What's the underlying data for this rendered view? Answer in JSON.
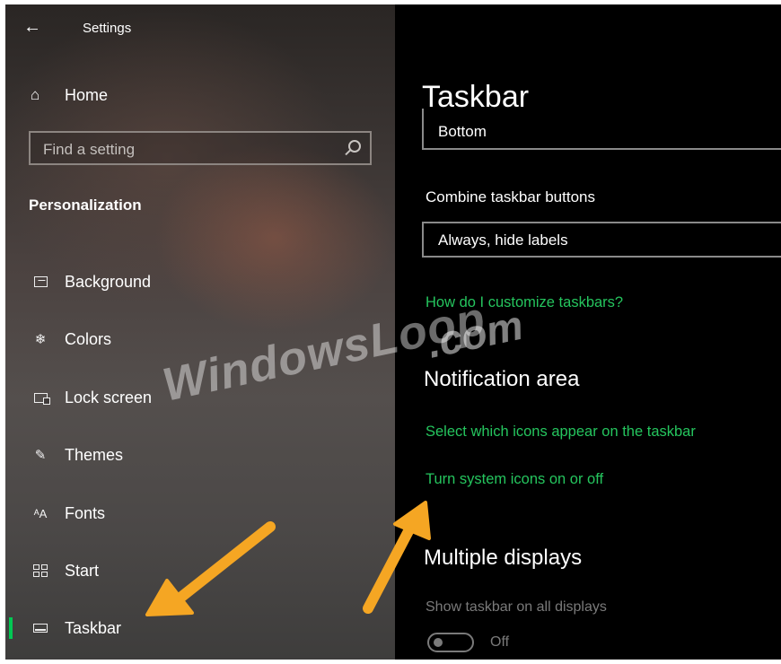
{
  "header": {
    "back_icon": "arrow-left-icon",
    "app_title": "Settings"
  },
  "sidebar": {
    "home_label": "Home",
    "search_placeholder": "Find a setting",
    "section_title": "Personalization",
    "items": [
      {
        "label": "Background",
        "icon": "background-icon"
      },
      {
        "label": "Colors",
        "icon": "palette-icon"
      },
      {
        "label": "Lock screen",
        "icon": "lock-screen-icon"
      },
      {
        "label": "Themes",
        "icon": "themes-icon"
      },
      {
        "label": "Fonts",
        "icon": "fonts-icon",
        "glyph": "ᴬA"
      },
      {
        "label": "Start",
        "icon": "start-icon"
      },
      {
        "label": "Taskbar",
        "icon": "taskbar-icon",
        "active": true
      }
    ]
  },
  "main": {
    "title": "Taskbar",
    "location_value": "Bottom",
    "combine_label": "Combine taskbar buttons",
    "combine_value": "Always, hide labels",
    "customize_link": "How do I customize taskbars?",
    "notification_heading": "Notification area",
    "select_icons_link": "Select which icons appear on the taskbar",
    "system_icons_link": "Turn system icons on or off",
    "multiple_heading": "Multiple displays",
    "show_all_label": "Show taskbar on all displays",
    "show_all_state": "Off"
  },
  "watermark": {
    "text": "WindowsLoop",
    "suffix": ".com"
  },
  "colors": {
    "accent": "#00c853",
    "link": "#25c55e",
    "arrow": "#f5a623"
  }
}
